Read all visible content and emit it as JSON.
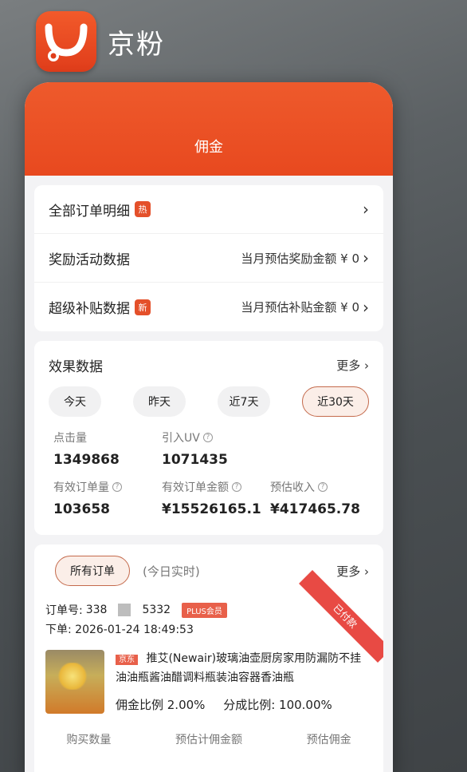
{
  "app": {
    "name": "京粉"
  },
  "window": {
    "title": "佣金"
  },
  "summary_rows": [
    {
      "label": "全部订单明细",
      "badge": "热",
      "right": ""
    },
    {
      "label": "奖励活动数据",
      "badge": "",
      "right": "当月预估奖励金额 ¥ 0"
    },
    {
      "label": "超级补贴数据",
      "badge": "新",
      "right": "当月预估补贴金额 ¥ 0"
    }
  ],
  "effect": {
    "title": "效果数据",
    "more": "更多",
    "periods": [
      "今天",
      "昨天",
      "近7天",
      "近30天"
    ],
    "active_period": "近30天",
    "stats": [
      {
        "label": "点击量",
        "value": "1349868",
        "help": false
      },
      {
        "label": "引入UV",
        "value": "1071435",
        "help": true
      },
      {
        "label": "",
        "value": "",
        "help": false
      },
      {
        "label": "有效订单量",
        "value": "103658",
        "help": true
      },
      {
        "label": "有效订单金额",
        "value": "¥15526165.1",
        "help": true
      },
      {
        "label": "预估收入",
        "value": "¥417465.78",
        "help": true
      }
    ]
  },
  "orders": {
    "tab": "所有订单",
    "realtime": "(今日实时)",
    "more": "更多",
    "order_no_label": "订单号:",
    "order_no_start": "338",
    "order_no_end": "5332",
    "plus_tag": "PLUS会员",
    "order_time": "下单: 2026-01-24 18:49:53",
    "paid": "已付款",
    "product_tag": "京东",
    "product_title": "推艾(Newair)玻璃油壶厨房家用防漏防不挂油油瓶酱油醋调料瓶装油容器香油瓶",
    "commission_rate": "佣金比例 2.00%",
    "share_rate": "分成比例: 100.00%",
    "bottom_labels": [
      "购买数量",
      "预估计佣金额",
      "预估佣金"
    ]
  },
  "colors": {
    "accent": "#e8491f",
    "badge": "#e4502a"
  }
}
